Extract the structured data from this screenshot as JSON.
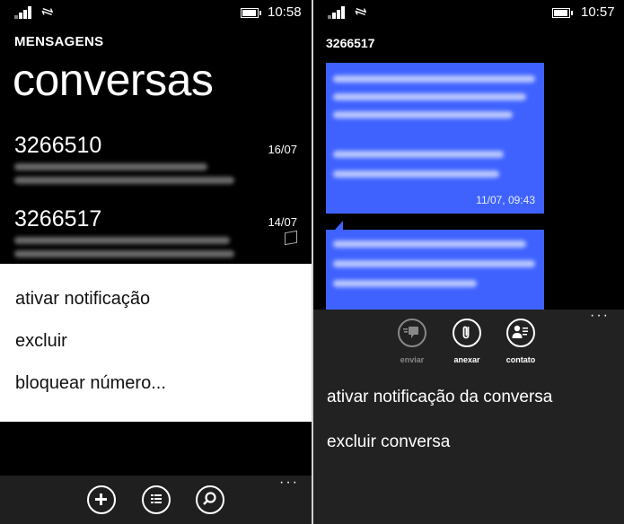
{
  "left": {
    "status": {
      "time": "10:58"
    },
    "app_title": "MENSAGENS",
    "pivot_title": "conversas",
    "conversations": [
      {
        "number": "3266510",
        "date": "16/07"
      },
      {
        "number": "3266517",
        "date": "14/07"
      }
    ],
    "context_menu": [
      "ativar notificação",
      "excluir",
      "bloquear número..."
    ],
    "appbar": {
      "more": "···"
    }
  },
  "right": {
    "status": {
      "time": "10:57"
    },
    "thread_title": "3266517",
    "bubble_time": "11/07, 09:43",
    "appbar": {
      "buttons": [
        {
          "label": "enviar",
          "icon": "send-icon",
          "disabled": true
        },
        {
          "label": "anexar",
          "icon": "paperclip-icon",
          "disabled": false
        },
        {
          "label": "contato",
          "icon": "contact-card-icon",
          "disabled": false
        }
      ],
      "more": "···",
      "menu": [
        "ativar notificação da conversa",
        "excluir conversa"
      ]
    }
  },
  "colors": {
    "bubble": "#3f62ff",
    "context_bg": "#ffffff",
    "appbar_bg": "#1f1f1f"
  }
}
